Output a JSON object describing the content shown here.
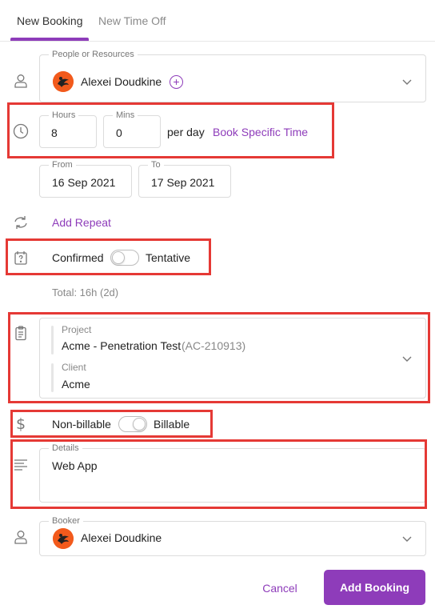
{
  "tabs": [
    {
      "label": "New Booking",
      "active": true
    },
    {
      "label": "New Time Off",
      "active": false
    }
  ],
  "people": {
    "legend": "People or Resources",
    "name": "Alexei Doudkine"
  },
  "time": {
    "hours_legend": "Hours",
    "hours_value": "8",
    "mins_legend": "Mins",
    "mins_value": "0",
    "per_day": "per day",
    "specific_time_link": "Book Specific Time"
  },
  "dates": {
    "from_legend": "From",
    "from_value": "16 Sep 2021",
    "to_legend": "To",
    "to_value": "17 Sep 2021"
  },
  "repeat": {
    "label": "Add Repeat"
  },
  "status": {
    "left_label": "Confirmed",
    "right_label": "Tentative"
  },
  "total": {
    "text": "Total: 16h (2d)"
  },
  "project": {
    "project_legend": "Project",
    "project_name": "Acme - Penetration Test",
    "project_code": "(AC-210913)",
    "client_legend": "Client",
    "client_name": "Acme"
  },
  "billing": {
    "left_label": "Non-billable",
    "right_label": "Billable"
  },
  "details": {
    "legend": "Details",
    "value": "Web App"
  },
  "booker": {
    "legend": "Booker",
    "name": "Alexei Doudkine"
  },
  "actions": {
    "cancel_label": "Cancel",
    "submit_label": "Add Booking"
  },
  "colors": {
    "accent": "#8e3cba",
    "highlight": "#e53935",
    "avatar": "#f25a1c"
  }
}
